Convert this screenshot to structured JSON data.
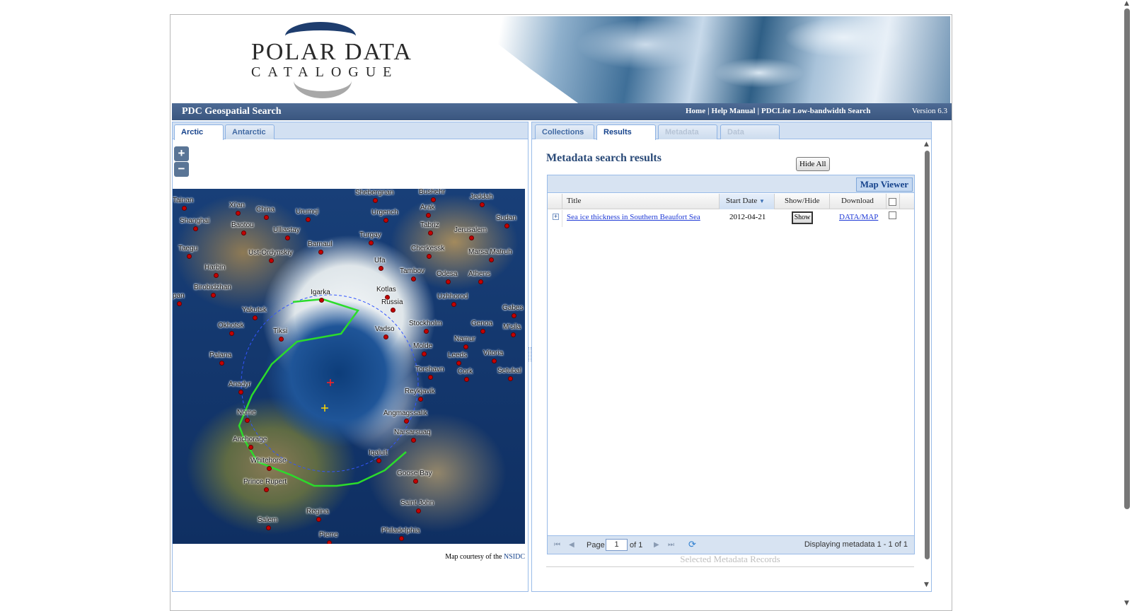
{
  "header": {
    "logo_line1": "POLAR DATA",
    "logo_line2": "CATALOGUE",
    "app_title": "PDC Geospatial Search",
    "links": [
      "Home",
      "Help Manual",
      "PDCLite Low-bandwidth Search"
    ],
    "version": "Version 6.3"
  },
  "left_panel": {
    "tabs": [
      "Arctic",
      "Antarctic"
    ],
    "active_tab": "Arctic",
    "zoom_in": "+",
    "zoom_out": "−",
    "map_credit_prefix": "Map courtesy of the",
    "map_credit_link": "NSIDC",
    "cities": [
      "Tainan",
      "Xi'an",
      "China",
      "Urumqi",
      "Shebergnan",
      "Bushehr",
      "Jeddah",
      "Shanghai",
      "Baotou",
      "Ulliastay",
      "Urgench",
      "Arak",
      "Sudan",
      "Turgay",
      "Tabriz",
      "Jerusalem",
      "Taegu",
      "Ust-Ordynskiy",
      "Barnaul",
      "Cherkessk",
      "Marsa Matruh",
      "Harbin",
      "Ufa",
      "Tambov",
      "Odesa",
      "Athens",
      "Birobidzhan",
      "Igarka",
      "Kotlas",
      "Uzhhorod",
      "pan",
      "Yakutsk",
      "Russia",
      "Gabes",
      "Okhotsk",
      "Tiksi",
      "Vadso",
      "Stockholm",
      "Genoa",
      "M'sila",
      "Namur",
      "Molde",
      "Leeds",
      "Vitoria",
      "Palana",
      "Torshavn",
      "Cork",
      "Setubal",
      "Anadyr",
      "Reykjavik",
      "Nome",
      "Angmagssalik",
      "Anchorage",
      "Narsarsuaq",
      "Iqaluit",
      "Whitehorse",
      "Goose Bay",
      "Prince Rupert",
      "Saint John",
      "Regina",
      "Salem",
      "Philadelphia",
      "Pierre"
    ]
  },
  "right_panel": {
    "tabs": [
      "Collections",
      "Results",
      "Metadata",
      "Data"
    ],
    "active_tab": "Results",
    "heading": "Metadata search results",
    "hide_all": "Hide All",
    "map_viewer": "Map Viewer",
    "columns": [
      "Title",
      "Start Date",
      "Show/Hide",
      "Download"
    ],
    "rows": [
      {
        "title": "Sea ice thickness in Southern Beaufort Sea",
        "start_date": "2012-04-21",
        "show_label": "Show",
        "download": "DATA/MAP"
      }
    ],
    "pager": {
      "page_label": "Page",
      "page_value": "1",
      "of_label": "of 1",
      "displaying": "Displaying metadata 1 - 1 of 1"
    },
    "selected_records": "Selected Metadata Records"
  }
}
